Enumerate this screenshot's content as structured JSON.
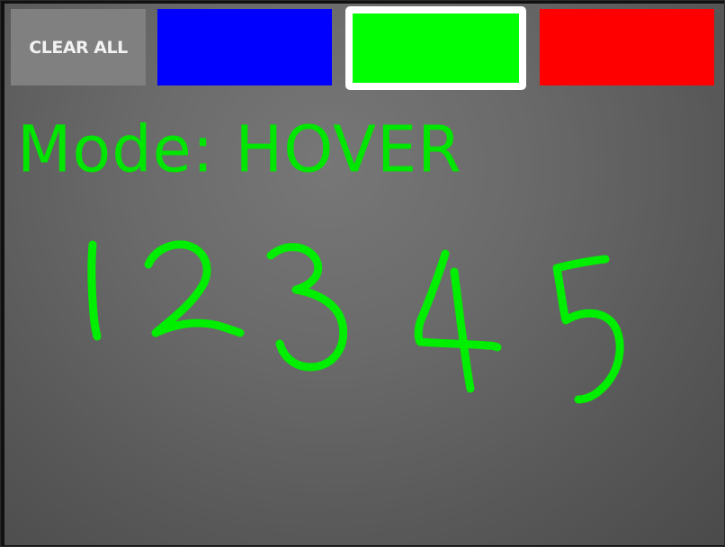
{
  "toolbar": {
    "clear_all_label": "CLEAR ALL",
    "swatches": [
      {
        "name": "blue",
        "color": "#0000ff",
        "selected": false
      },
      {
        "name": "green",
        "color": "#00ff00",
        "selected": true
      },
      {
        "name": "red",
        "color": "#ff0000",
        "selected": false
      }
    ],
    "selected_border_color": "#ffffff"
  },
  "status": {
    "mode_text": "Mode: HOVER",
    "mode_color": "#00e600"
  },
  "drawing": {
    "stroke_color": "#00ee00",
    "handwritten_text": "12345"
  }
}
